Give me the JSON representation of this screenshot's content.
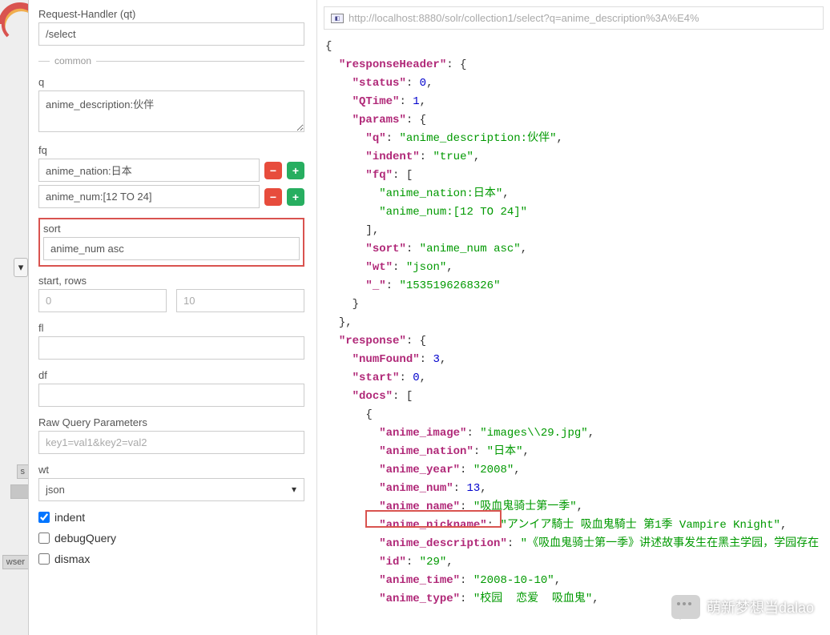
{
  "form": {
    "handler_label": "Request-Handler (qt)",
    "handler_value": "/select",
    "common_legend": "common",
    "q_label": "q",
    "q_value": "anime_description:伙伴",
    "fq_label": "fq",
    "fq1_value": "anime_nation:日本",
    "fq2_value": "anime_num:[12 TO 24]",
    "sort_label": "sort",
    "sort_value": "anime_num asc",
    "start_rows_label": "start, rows",
    "start_placeholder": "0",
    "rows_placeholder": "10",
    "fl_label": "fl",
    "df_label": "df",
    "raw_label": "Raw Query Parameters",
    "raw_placeholder": "key1=val1&key2=val2",
    "wt_label": "wt",
    "wt_value": "json",
    "indent_label": "indent",
    "debug_label": "debugQuery",
    "dismax_label": "dismax"
  },
  "sidebar": {
    "nav1": "s",
    "nav3": "wser"
  },
  "url": "http://localhost:8880/solr/collection1/select?q=anime_description%3A%E4%",
  "json_display": {
    "responseHeader": "responseHeader",
    "status_k": "status",
    "status_v": "0",
    "qtime_k": "QTime",
    "qtime_v": "1",
    "params_k": "params",
    "q_k": "q",
    "q_v": "anime_description:伙伴",
    "indent_k": "indent",
    "indent_v": "true",
    "fq_k": "fq",
    "fq_v1": "anime_nation:日本",
    "fq_v2": "anime_num:[12 TO 24]",
    "sort_k": "sort",
    "sort_v": "anime_num asc",
    "wt_k": "wt",
    "wt_v": "json",
    "ts_k": "_",
    "ts_v": "1535196268326",
    "response_k": "response",
    "numfound_k": "numFound",
    "numfound_v": "3",
    "start_k": "start",
    "start_v": "0",
    "docs_k": "docs",
    "img_k": "anime_image",
    "img_v": "images\\\\29.jpg",
    "nation_k": "anime_nation",
    "nation_v": "日本",
    "year_k": "anime_year",
    "year_v": "2008",
    "num_k": "anime_num",
    "num_v": "13",
    "name_k": "anime_name",
    "name_v": "吸血鬼骑士第一季",
    "nick_k": "anime_nickname",
    "nick_v": "アンイア騎士 吸血鬼騎士 第1季 Vampire Knight",
    "desc_k": "anime_description",
    "desc_v": "《吸血鬼骑士第一季》讲述故事发生在黑主学园，学园存在",
    "id_k": "id",
    "id_v": "29",
    "time_k": "anime_time",
    "time_v": "2008-10-10",
    "type_k": "anime_type",
    "type_v": "校园  恋爱  吸血鬼"
  },
  "watermark": "萌新梦想当dalao"
}
